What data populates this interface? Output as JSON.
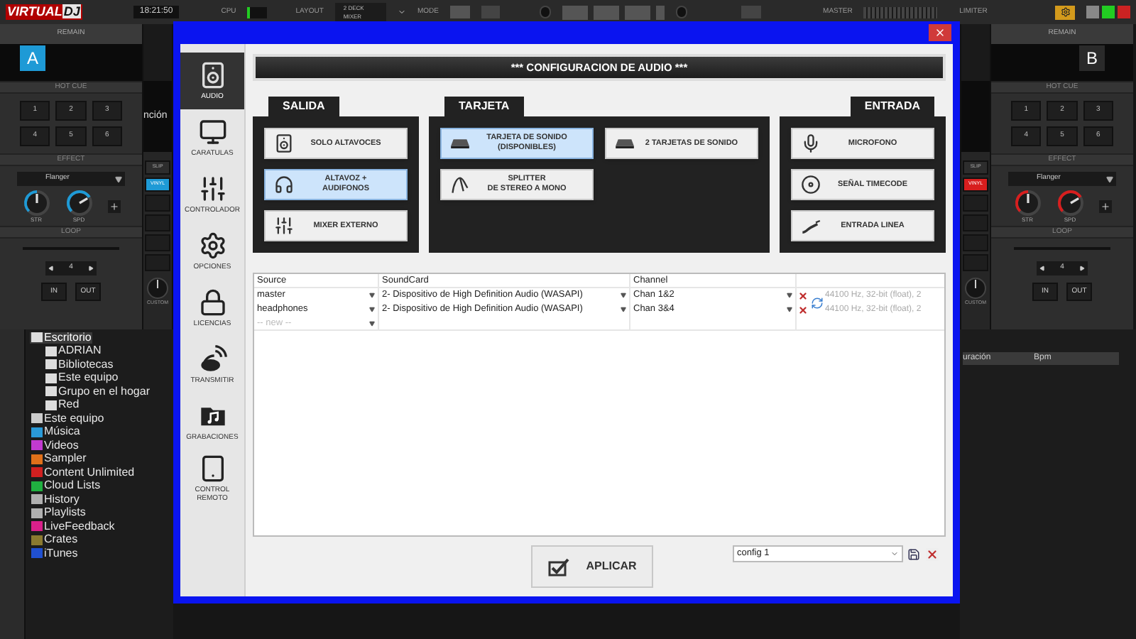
{
  "top_bar": {
    "logo_a": "VIRTUAL",
    "logo_b": "DJ",
    "clock": "18:21:50",
    "cpu_label": "CPU",
    "layout_label": "LAYOUT",
    "layout_value": "2 DECK MIXER",
    "mode_label": "MODE",
    "master_label": "MASTER",
    "limiter_label": "LIMITER"
  },
  "decks": [
    {
      "letter": "A",
      "remain": "REMAIN",
      "color": "#1e9ad6",
      "strip_title": "nción",
      "hot_cue_title": "HOT CUE",
      "hot_cues": [
        "1",
        "2",
        "3",
        "4",
        "5",
        "6"
      ],
      "effect_title": "EFFECT",
      "effect": "Flanger",
      "knobs": [
        {
          "label": "STR",
          "level": 0.5
        },
        {
          "label": "SPD",
          "level": 0.72
        }
      ],
      "loop_title": "LOOP",
      "loop_value": "4",
      "loop_buttons": [
        "IN",
        "OUT"
      ],
      "slip": "SLIP",
      "vinyl": "VINYL",
      "custom": "CUSTOM"
    },
    {
      "letter": "B",
      "remain": "REMAIN",
      "color": "#d81e1e",
      "hot_cue_title": "HOT CUE",
      "hot_cues": [
        "1",
        "2",
        "3",
        "4",
        "5",
        "6"
      ],
      "effect_title": "EFFECT",
      "effect": "Flanger",
      "knobs": [
        {
          "label": "STR",
          "level": 0.5
        },
        {
          "label": "SPD",
          "level": 0.72
        }
      ],
      "loop_title": "LOOP",
      "loop_value": "4",
      "loop_buttons": [
        "IN",
        "OUT"
      ],
      "slip": "SLIP",
      "vinyl": "VINYL",
      "custom": "CUSTOM"
    }
  ],
  "browser": {
    "tree": [
      {
        "label": "Escritorio",
        "color": "#dddddd",
        "selected": true,
        "children": [
          {
            "label": "ADRIAN",
            "color": "#dddddd",
            "selected": false
          },
          {
            "label": "Bibliotecas",
            "color": "#dddddd",
            "selected": false
          },
          {
            "label": "Este equipo",
            "color": "#dddddd",
            "selected": false
          },
          {
            "label": "Grupo en el hogar",
            "color": "#dddddd",
            "selected": false
          },
          {
            "label": "Red",
            "color": "#dddddd",
            "selected": false
          }
        ]
      },
      {
        "label": "Este equipo",
        "color": "#cccccc",
        "selected": false
      },
      {
        "label": "Música",
        "color": "#2a9ad8",
        "selected": false
      },
      {
        "label": "Videos",
        "color": "#c23ad0",
        "selected": false
      },
      {
        "label": "Sampler",
        "color": "#e0701a",
        "selected": false
      },
      {
        "label": "Content Unlimited",
        "color": "#d02020",
        "selected": false
      },
      {
        "label": "Cloud Lists",
        "color": "#20b040",
        "selected": false
      },
      {
        "label": "History",
        "color": "#b0b0b0",
        "selected": false
      },
      {
        "label": "Playlists",
        "color": "#b0b0b0",
        "selected": false
      },
      {
        "label": "LiveFeedback",
        "color": "#d8208a",
        "selected": false
      },
      {
        "label": "Crates",
        "color": "#8a7a30",
        "selected": false
      },
      {
        "label": "iTunes",
        "color": "#2050d0",
        "selected": false
      }
    ],
    "columns": [
      "uración",
      "Bpm"
    ]
  },
  "dialog": {
    "sidebar": [
      {
        "label": "AUDIO",
        "selected": true
      },
      {
        "label": "CARATULAS",
        "selected": false
      },
      {
        "label": "CONTROLADOR",
        "selected": false
      },
      {
        "label": "OPCIONES",
        "selected": false
      },
      {
        "label": "LICENCIAS",
        "selected": false
      },
      {
        "label": "TRANSMITIR",
        "selected": false
      },
      {
        "label": "GRABACIONES",
        "selected": false
      },
      {
        "label": "CONTROL REMOTO",
        "selected": false
      }
    ],
    "header": "*** CONFIGURACION DE AUDIO ***",
    "groups": [
      {
        "title": "SALIDA",
        "buttons": [
          {
            "lines": [
              "SOLO ALTAVOCES"
            ],
            "selected": false
          },
          {
            "lines": [
              "ALTAVOZ +",
              "AUDIFONOS"
            ],
            "selected": true
          },
          {
            "lines": [
              "MIXER EXTERNO"
            ],
            "selected": false
          }
        ]
      },
      {
        "title": "TARJETA",
        "buttons": [
          {
            "lines": [
              "TARJETA DE SONIDO",
              "(DISPONIBLES)"
            ],
            "selected": true
          },
          {
            "lines": [
              "2 TARJETAS DE SONIDO"
            ],
            "selected": false
          },
          {
            "lines": [
              "SPLITTER",
              "DE STEREO A MONO"
            ],
            "selected": false
          }
        ]
      },
      {
        "title": "ENTRADA",
        "buttons": [
          {
            "lines": [
              "MICROFONO"
            ],
            "selected": false
          },
          {
            "lines": [
              "SEÑAL TIMECODE"
            ],
            "selected": false
          },
          {
            "lines": [
              "ENTRADA LINEA"
            ],
            "selected": false
          }
        ]
      }
    ],
    "table": {
      "columns": [
        "Source",
        "SoundCard",
        "Channel"
      ],
      "rows": [
        {
          "source": "master",
          "soundcard": "2- Dispositivo de High Definition Audio (WASAPI)",
          "channel": "Chan 1&2",
          "info": "44100 Hz, 32-bit (float), 2"
        },
        {
          "source": "headphones",
          "soundcard": "2- Dispositivo de High Definition Audio (WASAPI)",
          "channel": "Chan 3&4",
          "info": "44100 Hz, 32-bit (float), 2"
        }
      ],
      "new_row": "-- new --"
    },
    "apply": "APLICAR",
    "config": "config 1"
  }
}
